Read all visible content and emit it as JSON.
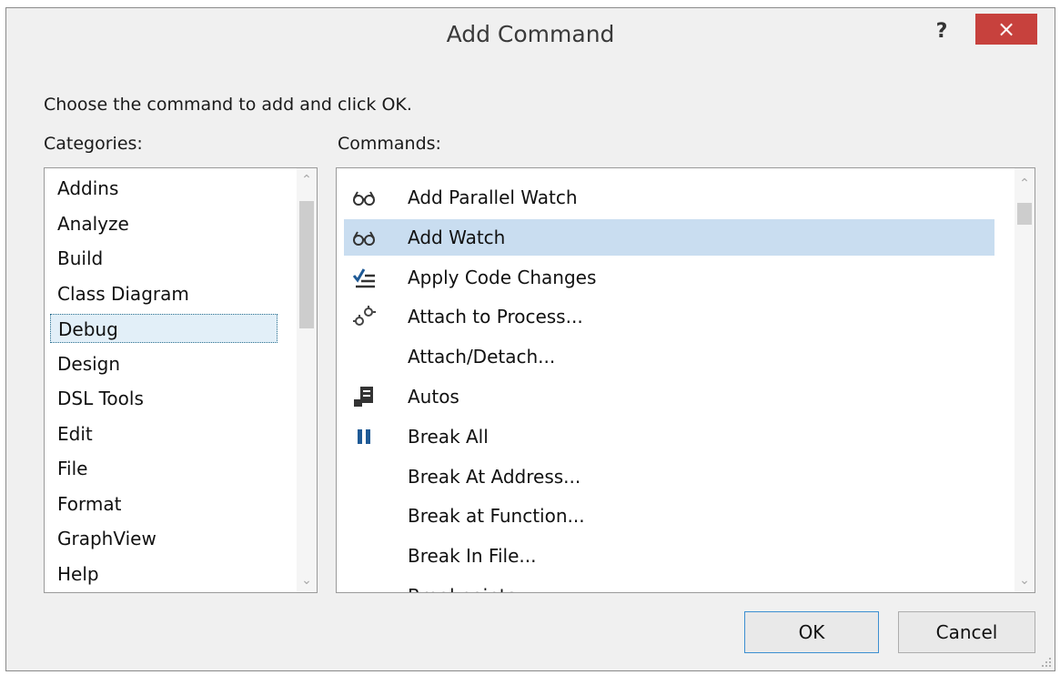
{
  "dialog": {
    "title": "Add Command",
    "help_label": "?",
    "close_label": "×",
    "prompt": "Choose the command to add and click OK."
  },
  "categories": {
    "label": "Categories:",
    "items": [
      {
        "label": "Addins"
      },
      {
        "label": "Analyze"
      },
      {
        "label": "Build"
      },
      {
        "label": "Class Diagram"
      },
      {
        "label": "Debug",
        "selected": true
      },
      {
        "label": "Design"
      },
      {
        "label": "DSL Tools"
      },
      {
        "label": "Edit"
      },
      {
        "label": "File"
      },
      {
        "label": "Format"
      },
      {
        "label": "GraphView"
      },
      {
        "label": "Help"
      }
    ]
  },
  "commands": {
    "label": "Commands:",
    "items": [
      {
        "label": "Add Parallel Watch",
        "icon": "glasses-icon"
      },
      {
        "label": "Add Watch",
        "icon": "glasses-icon",
        "selected": true
      },
      {
        "label": "Apply Code Changes",
        "icon": "apply-changes-icon"
      },
      {
        "label": "Attach to Process...",
        "icon": "gears-icon"
      },
      {
        "label": "Attach/Detach...",
        "icon": ""
      },
      {
        "label": "Autos",
        "icon": "autos-icon"
      },
      {
        "label": "Break All",
        "icon": "pause-icon"
      },
      {
        "label": "Break At Address...",
        "icon": ""
      },
      {
        "label": "Break at Function...",
        "icon": ""
      },
      {
        "label": "Break In File...",
        "icon": ""
      },
      {
        "label": "Breakpoints",
        "icon": "breakpoints-icon"
      }
    ]
  },
  "buttons": {
    "ok_label": "OK",
    "cancel_label": "Cancel"
  },
  "colors": {
    "close_button": "#c7413d",
    "selection": "#c9ddf0",
    "ok_border": "#3c8fd1",
    "pause_icon": "#1f5a96"
  }
}
